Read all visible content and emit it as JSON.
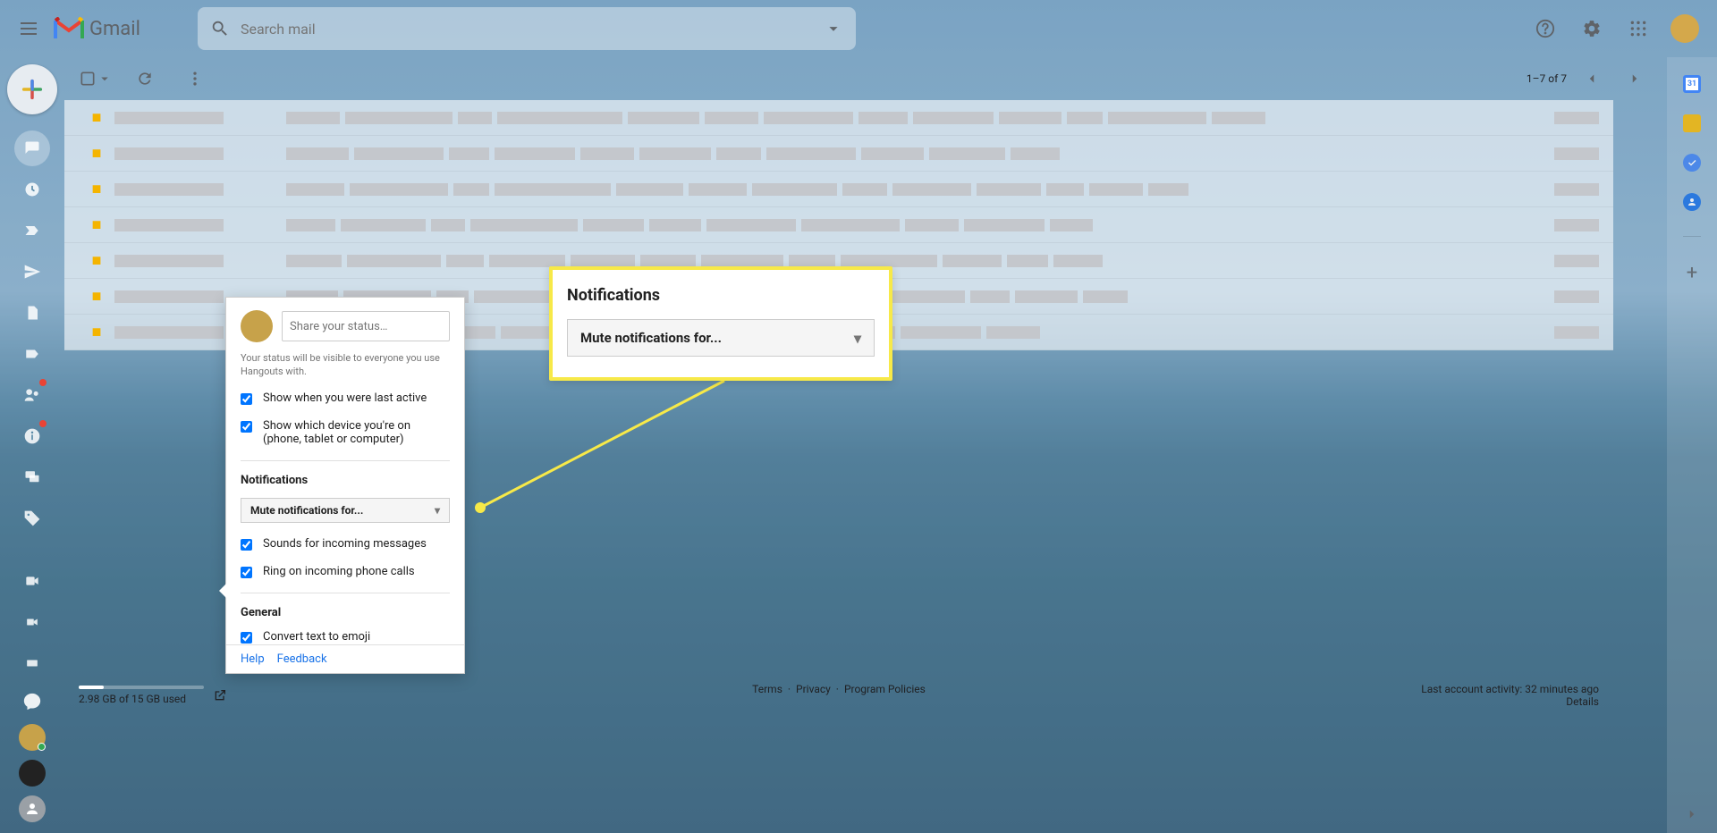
{
  "header": {
    "app_name": "Gmail",
    "search_placeholder": "Search mail"
  },
  "toolbar": {
    "page_info": "1–7 of 7"
  },
  "footer": {
    "storage_text": "2.98 GB of 15 GB used",
    "terms": "Terms",
    "privacy": "Privacy",
    "policies": "Program Policies",
    "activity": "Last account activity: 32 minutes ago",
    "details": "Details",
    "dot1": "·",
    "dot2": "·"
  },
  "hangouts": {
    "status_placeholder": "Share your status…",
    "visibility_note": "Your status will be visible to everyone you use Hangouts with.",
    "show_last_active": "Show when you were last active",
    "show_device": "Show which device you're on (phone, tablet or computer)",
    "notifications_title": "Notifications",
    "mute_label": "Mute notifications for...",
    "sounds_incoming": "Sounds for incoming messages",
    "ring_incoming": "Ring on incoming phone calls",
    "general_title": "General",
    "convert_emoji": "Convert text to emoji",
    "help": "Help",
    "feedback": "Feedback"
  },
  "callout": {
    "title": "Notifications",
    "select_label": "Mute notifications for..."
  },
  "right_panel": {
    "icons": [
      "calendar",
      "keep",
      "tasks",
      "contacts"
    ]
  },
  "email_rows": 7
}
